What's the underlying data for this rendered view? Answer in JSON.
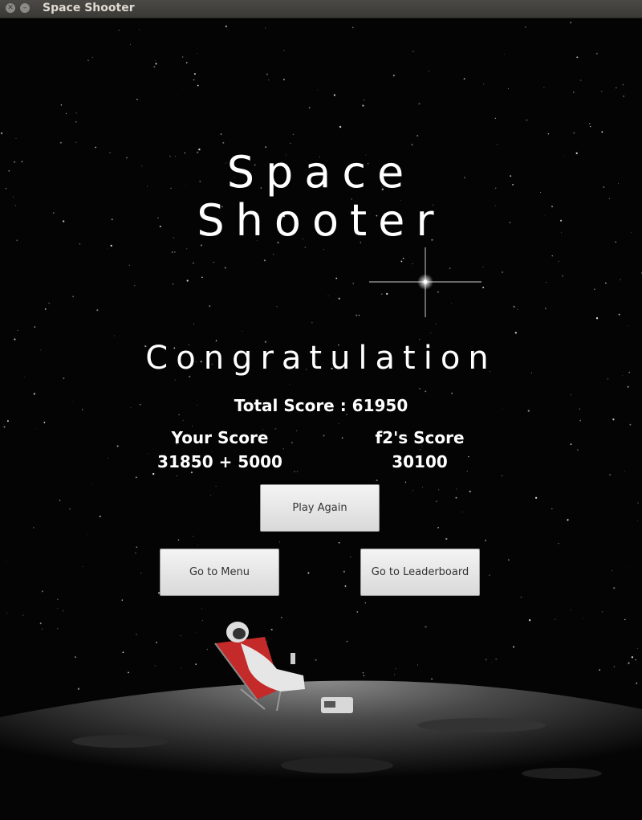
{
  "window": {
    "title": "Space Shooter"
  },
  "game": {
    "title_line1": "Space",
    "title_line2": "Shooter",
    "message": "Congratulation",
    "total_score": "Total Score : 61950",
    "player": {
      "label": "Your Score",
      "value": "31850 + 5000"
    },
    "partner": {
      "label": "f2's Score",
      "value": "30100"
    }
  },
  "buttons": {
    "play_again": "Play Again",
    "menu": "Go to Menu",
    "leaderboard": "Go to Leaderboard"
  }
}
